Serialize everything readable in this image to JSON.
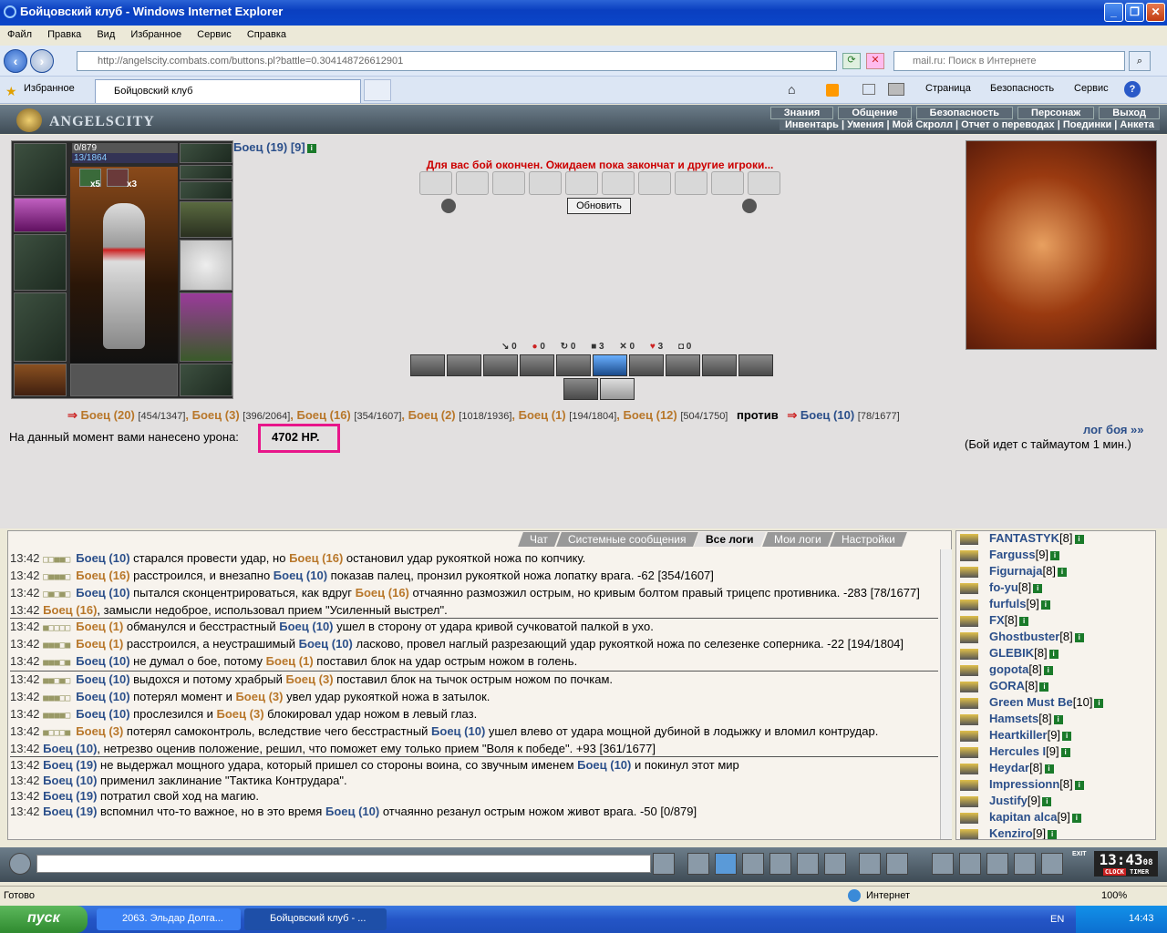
{
  "window": {
    "title": "Бойцовский клуб - Windows Internet Explorer"
  },
  "menu": [
    "Файл",
    "Правка",
    "Вид",
    "Избранное",
    "Сервис",
    "Справка"
  ],
  "address": {
    "url": "http://angelscity.combats.com/buttons.pl?battle=0.304148726612901",
    "search_placeholder": "mail.ru: Поиск в Интернете"
  },
  "tabs": {
    "favorites": "Избранное",
    "active_tab": "Бойцовский клуб"
  },
  "toolbar": {
    "page": "Страница",
    "safety": "Безопасность",
    "service": "Сервис"
  },
  "game": {
    "logo": "ANGELSCITY",
    "nav_top": [
      "Знания",
      "Общение",
      "Безопасность",
      "Персонаж",
      "Выход"
    ],
    "nav_bottom": "Инвентарь | Умения | Мой Скролл | Отчет о переводах | Поединки | Анкета",
    "hp": "0/879",
    "mana": "13/1864",
    "x5": "x5",
    "x3": "x3",
    "fighter": "Боец (19) [9]",
    "finished": "Для вас бой окончен. Ожидаем пока закончат и другие игроки...",
    "refresh": "Обновить",
    "stats": [
      "0",
      "0",
      "0",
      "3",
      "0",
      "3",
      "0"
    ],
    "team_left": [
      {
        "name": "Боец (20)",
        "hp": "[454/1347]"
      },
      {
        "name": "Боец (3)",
        "hp": "[396/2064]"
      },
      {
        "name": "Боец (16)",
        "hp": "[354/1607]"
      },
      {
        "name": "Боец (2)",
        "hp": "[1018/1936]"
      },
      {
        "name": "Боец (1)",
        "hp": "[194/1804]"
      },
      {
        "name": "Боец (12)",
        "hp": "[504/1750]"
      }
    ],
    "vs": "против",
    "team_right": {
      "name": "Боец (10)",
      "hp": "[78/1677]"
    },
    "damage_text": "На данный момент вами нанесено урона:",
    "damage_value": "4702 HP.",
    "log_link": "лог боя »»",
    "timeout": "(Бой идет с таймаутом 1 мин.)"
  },
  "chat_tabs": [
    "Чат",
    "Системные сообщения",
    "Все логи",
    "Мои логи",
    "Настройки"
  ],
  "chat_lines": [
    {
      "t": "13:42",
      "ic": "□□■■□",
      "a": "Боец (10)",
      "ac": "pb",
      "m": " старался провести удар, но ",
      "b": "Боец (16)",
      "bc": "po",
      "e": " остановил удар рукояткой ножа по копчику."
    },
    {
      "t": "13:42",
      "ic": "□■■■□",
      "a": "Боец (16)",
      "ac": "po",
      "m": " расстроился, и внезапно ",
      "b": "Боец (10)",
      "bc": "pb",
      "e": " показав палец, пронзил рукояткой ножа лопатку врага. -62 [354/1607]"
    },
    {
      "t": "13:42",
      "ic": "□■□■□",
      "a": "Боец (10)",
      "ac": "pb",
      "m": " пытался сконцентрироваться, как вдруг ",
      "b": "Боец (16)",
      "bc": "po",
      "e": " отчаянно размозжил острым, но кривым болтом правый трицепс противника. -283 [78/1677]",
      "wrap": true
    },
    {
      "t": "13:42",
      "ic": "",
      "a": "Боец (16)",
      "ac": "po",
      "m": ", замысли недоброе, использовал прием \"Усиленный выстрел\".",
      "b": "",
      "bc": "",
      "e": ""
    },
    {
      "t": "13:42",
      "ic": "■□□□□",
      "a": "Боец (1)",
      "ac": "po",
      "m": " обманулся и бесстрастный ",
      "b": "Боец (10)",
      "bc": "pb",
      "e": " ушел в сторону от удара кривой сучковатой палкой в ухо.",
      "hr": true
    },
    {
      "t": "13:42",
      "ic": "■■■□■",
      "a": "Боец (1)",
      "ac": "po",
      "m": " расстроился, а неустрашимый ",
      "b": "Боец (10)",
      "bc": "pb",
      "e": " ласково, провел наглый разрезающий удар рукояткой ножа по селезенке соперника. -22 [194/1804]",
      "wrap": true
    },
    {
      "t": "13:42",
      "ic": "■■■□■",
      "a": "Боец (10)",
      "ac": "pb",
      "m": " не думал о бое, потому ",
      "b": "Боец (1)",
      "bc": "po",
      "e": " поставил блок на удар острым ножом в голень."
    },
    {
      "t": "13:42",
      "ic": "■■□■□",
      "a": "Боец (10)",
      "ac": "pb",
      "m": " выдохся и потому храбрый ",
      "b": "Боец (3)",
      "bc": "po",
      "e": " поставил блок на тычок острым ножом по почкам.",
      "hr": true
    },
    {
      "t": "13:42",
      "ic": "■■■□□",
      "a": "Боец (10)",
      "ac": "pb",
      "m": " потерял момент и ",
      "b": "Боец (3)",
      "bc": "po",
      "e": " увел удар рукояткой ножа в затылок."
    },
    {
      "t": "13:42",
      "ic": "■■■■□",
      "a": "Боец (10)",
      "ac": "pb",
      "m": " прослезился и ",
      "b": "Боец (3)",
      "bc": "po",
      "e": " блокировал удар ножом в левый глаз."
    },
    {
      "t": "13:42",
      "ic": "■□□□■",
      "a": "Боец (3)",
      "ac": "po",
      "m": " потерял самоконтроль, вследствие чего бесстрастный ",
      "b": "Боец (10)",
      "bc": "pb",
      "e": " ушел влево от удара мощной дубиной в лодыжку и вломил контрудар.",
      "wrap": true
    },
    {
      "t": "13:42",
      "ic": "",
      "a": "Боец (10)",
      "ac": "pb",
      "m": ", нетрезво оценив положение, решил, что поможет ему только прием \"Воля к победе\". +93 [361/1677]",
      "b": "",
      "bc": "",
      "e": ""
    },
    {
      "t": "13:42",
      "ic": "",
      "a": "Боец (19)",
      "ac": "pb",
      "m": " не выдержал мощного удара, который пришел со стороны воина, со звучным именем ",
      "b": "Боец (10)",
      "bc": "pb",
      "e": " и покинул этот мир",
      "hr": true
    },
    {
      "t": "13:42",
      "ic": "",
      "a": "Боец (10)",
      "ac": "pb",
      "m": " применил заклинание \"Тактика Контрудара\".",
      "b": "",
      "bc": "",
      "e": ""
    },
    {
      "t": "13:42",
      "ic": "",
      "a": "Боец (19)",
      "ac": "pb",
      "m": " потратил свой ход на магию.",
      "b": "",
      "bc": "",
      "e": ""
    },
    {
      "t": "13:42",
      "ic": "",
      "a": "Боец (19)",
      "ac": "pb",
      "m": " вспомнил что-то важное, но в это время ",
      "b": "Боец (10)",
      "bc": "pb",
      "e": " отчаянно резанул острым ножом живот врага. -50 [0/879]"
    }
  ],
  "users": [
    {
      "n": "FANTASTYK",
      "l": "[8]"
    },
    {
      "n": "Farguss",
      "l": "[9]"
    },
    {
      "n": "Figurnaja",
      "l": "[8]"
    },
    {
      "n": "fo-yu",
      "l": "[8]"
    },
    {
      "n": "furfuls",
      "l": "[9]"
    },
    {
      "n": "FX",
      "l": "[8]"
    },
    {
      "n": "Ghostbuster",
      "l": "[8]"
    },
    {
      "n": "GLEBIK",
      "l": "[8]"
    },
    {
      "n": "gopota",
      "l": "[8]"
    },
    {
      "n": "GORA",
      "l": "[8]"
    },
    {
      "n": "Green Must Be",
      "l": "[10]"
    },
    {
      "n": "Hamsets",
      "l": "[8]"
    },
    {
      "n": "Heartkiller",
      "l": "[9]"
    },
    {
      "n": "Hercules I",
      "l": "[9]"
    },
    {
      "n": "Heydar",
      "l": "[8]"
    },
    {
      "n": "Impressionn",
      "l": "[8]"
    },
    {
      "n": "Justify",
      "l": "[9]"
    },
    {
      "n": "kapitan alca",
      "l": "[9]"
    },
    {
      "n": "Kenziro",
      "l": "[9]"
    }
  ],
  "clock": {
    "time": "13:43",
    "sec": "08",
    "label_clock": "CLOCK",
    "label_timer": "TIMER",
    "exit": "EXIT"
  },
  "statusbar": {
    "left": "Готово",
    "zone": "Интернет",
    "zoom": "100%"
  },
  "taskbar": {
    "start": "пуск",
    "item1": "2063. Эльдар Долга...",
    "item2": "Бойцовский клуб - ...",
    "lang": "EN",
    "time": "14:43"
  }
}
